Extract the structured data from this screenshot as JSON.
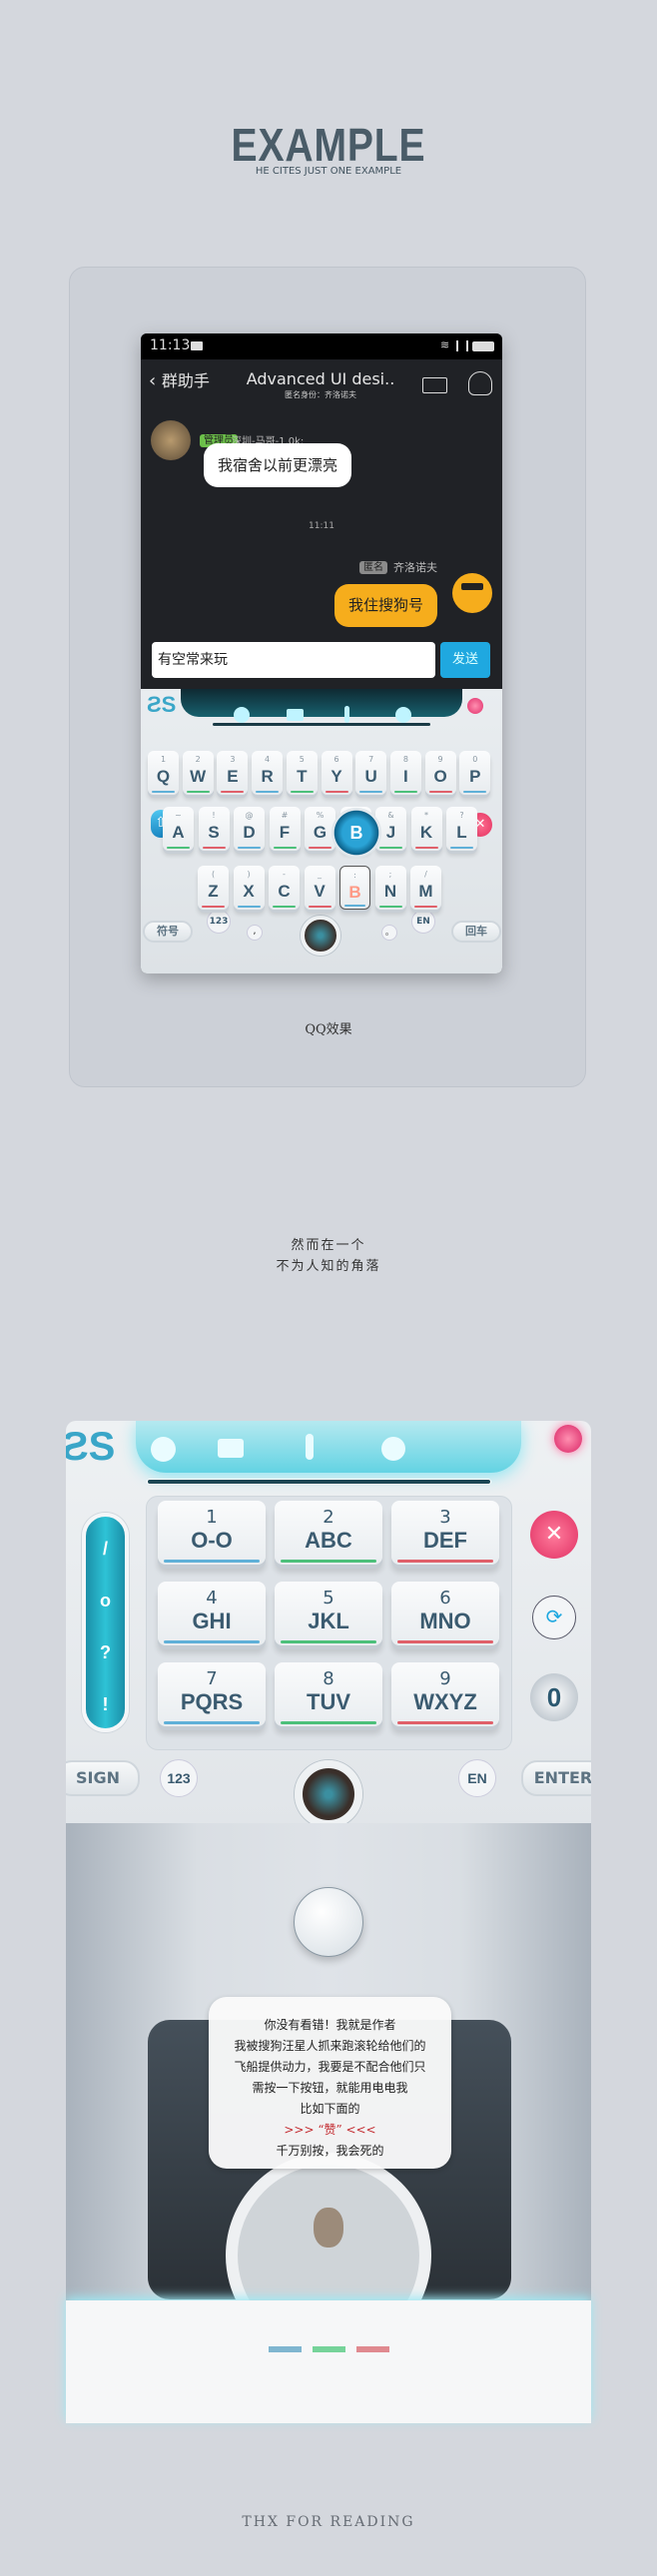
{
  "header": {
    "title": "EXAMPLE",
    "subtitle": "HE CITES JUST ONE EXAMPLE"
  },
  "phone": {
    "status": {
      "time": "11:13"
    },
    "nav": {
      "back_label": "群助手",
      "title": "Advanced UI desi..",
      "subtitle": "匿名身份：齐洛诺夫"
    },
    "messages": [
      {
        "tag": "管理员",
        "sender": "深圳-马哥-1.0k:",
        "text": "我宿舍以前更漂亮",
        "side": "left"
      },
      {
        "tag": "匿名",
        "sender": "齐洛诺夫",
        "text": "我住搜狗号",
        "side": "right"
      }
    ],
    "timestamp": "11:11",
    "input": {
      "value": "有空常来玩",
      "send_label": "发送"
    },
    "keyboard": {
      "rows": [
        [
          [
            "1",
            "Q"
          ],
          [
            "2",
            "W"
          ],
          [
            "3",
            "E"
          ],
          [
            "4",
            "R"
          ],
          [
            "5",
            "T"
          ],
          [
            "6",
            "Y"
          ],
          [
            "7",
            "U"
          ],
          [
            "8",
            "I"
          ],
          [
            "9",
            "O"
          ],
          [
            "0",
            "P"
          ]
        ],
        [
          [
            "~",
            "A"
          ],
          [
            "!",
            "S"
          ],
          [
            "@",
            "D"
          ],
          [
            "#",
            "F"
          ],
          [
            "%",
            "G"
          ],
          [
            "",
            "H"
          ],
          [
            "&",
            "J"
          ],
          [
            "*",
            "K"
          ],
          [
            "?",
            "L"
          ]
        ],
        [
          [
            "(",
            "Z"
          ],
          [
            ")",
            "X"
          ],
          [
            "-",
            "C"
          ],
          [
            "_",
            "V"
          ],
          [
            ":",
            "B"
          ],
          [
            ";",
            "N"
          ],
          [
            "/",
            "M"
          ]
        ]
      ],
      "pressed_key": "B",
      "symbol_label": "符号",
      "num_label": "123",
      "comma": ",",
      "period": "。",
      "lang_label": "EN",
      "enter_label": "回车"
    }
  },
  "caption_qq": "QQ效果",
  "intro": [
    "然而在一个",
    "不为人知的角落"
  ],
  "big_keyboard": {
    "keys": [
      [
        "1",
        "O-O"
      ],
      [
        "2",
        "ABC"
      ],
      [
        "3",
        "DEF"
      ],
      [
        "4",
        "GHI"
      ],
      [
        "5",
        "JKL"
      ],
      [
        "6",
        "MNO"
      ],
      [
        "7",
        "PQRS"
      ],
      [
        "8",
        "TUV"
      ],
      [
        "9",
        "WXYZ"
      ]
    ],
    "punct": [
      "/",
      "o",
      "?",
      "!"
    ],
    "zero_label": "0",
    "sign_label": "SIGN",
    "num_label": "123",
    "lang_label": "EN",
    "enter_label": "ENTER"
  },
  "speech": {
    "lines": [
      "你没有看错！我就是作者",
      "我被搜狗汪星人抓来跑滚轮给他们的",
      "飞船提供动力，我要是不配合他们只",
      "需按一下按钮，就能用电电我",
      "比如下面的"
    ],
    "highlight": ">>> “赞” <<<",
    "last": "千万别按，我会死的"
  },
  "footer": "THX FOR READING",
  "colors": {
    "accent": "#1fa8e0",
    "bubble_right": "#f6ad1c",
    "admin_tag": "#6cc04a",
    "delete": "#ef3f6a",
    "teal": "#1fb4c7",
    "bar_blue": "#5fb0d8",
    "bar_green": "#4cc07a",
    "bar_red": "#e0606a"
  }
}
